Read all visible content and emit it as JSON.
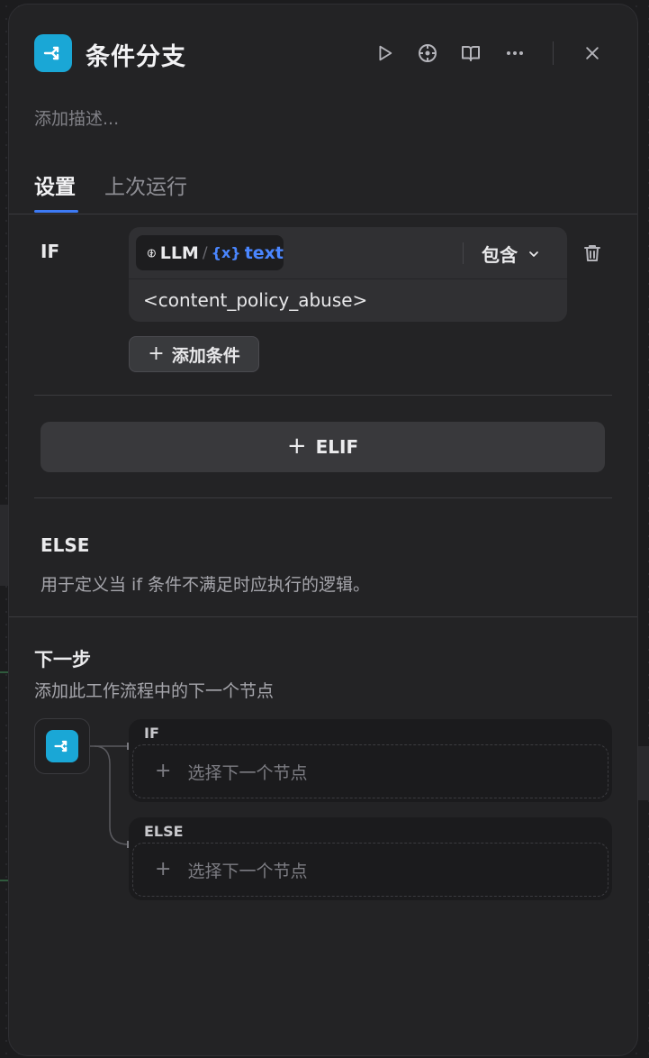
{
  "header": {
    "title": "条件分支",
    "description_placeholder": "添加描述..."
  },
  "tabs": [
    {
      "label": "设置",
      "active": true
    },
    {
      "label": "上次运行",
      "active": false
    }
  ],
  "if_block": {
    "label": "IF",
    "condition": {
      "variable_node": "LLM",
      "variable_icon": "{x}",
      "variable_name": "text",
      "operator": "包含",
      "value": "<content_policy_abuse>"
    },
    "add_condition_label": "添加条件"
  },
  "elif_label": "ELIF",
  "else_block": {
    "label": "ELSE",
    "description": "用于定义当 if 条件不满足时应执行的逻辑。"
  },
  "next_step": {
    "title": "下一步",
    "description": "添加此工作流程中的下一个节点",
    "branches": [
      {
        "label": "IF",
        "placeholder": "选择下一个节点"
      },
      {
        "label": "ELSE",
        "placeholder": "选择下一个节点"
      }
    ]
  },
  "colors": {
    "accent_blue": "#3d7af5",
    "node_badge": "#1aa7d6",
    "variable_blue": "#4a86ff"
  }
}
